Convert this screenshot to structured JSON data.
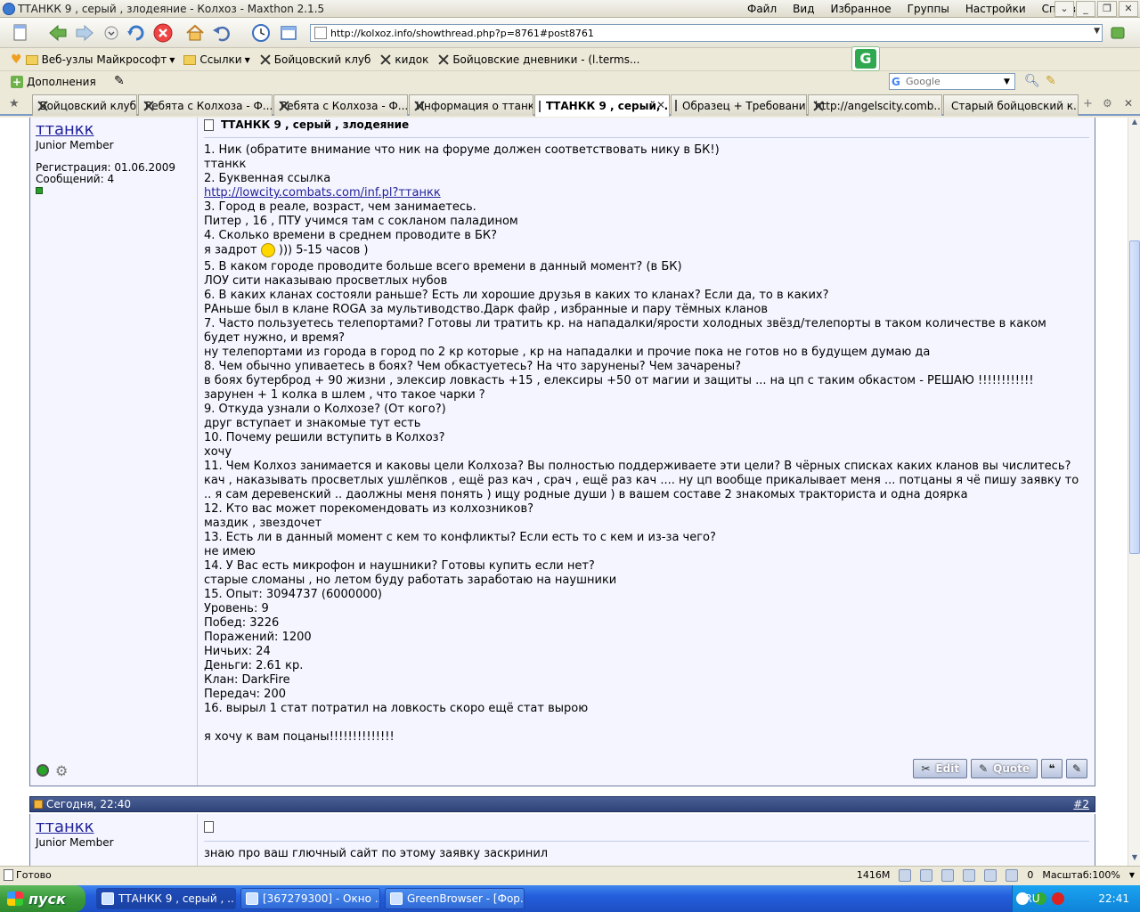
{
  "window": {
    "title": "ТТАНКК 9 , серый , злодеяние - Колхоз - Maxthon 2.1.5",
    "menu": [
      "Файл",
      "Вид",
      "Избранное",
      "Группы",
      "Настройки",
      "Справка"
    ]
  },
  "address": {
    "url": "http://kolxoz.info/showthread.php?p=8761#post8761"
  },
  "links": [
    "Веб-узлы Майкрософт",
    "Ссылки",
    "Бойцовский клуб",
    "кидок",
    "Бойцовские дневники - (l.terms..."
  ],
  "addons": {
    "label": "Дополнения"
  },
  "search": {
    "placeholder": "Google"
  },
  "tabs": [
    "Бойцовский клуб",
    "Ребята с Колхоза - Ф...",
    "Ребята с Колхоза - Ф...",
    "Информация о ттанкк",
    "ТТАНКК 9 , серый, ...",
    "Образец + Требовани...",
    "http://angelscity.comb...",
    "Старый бойцовский к..."
  ],
  "post1": {
    "username": "ттанкк",
    "usertitle": "Junior Member",
    "reg": "Регистрация: 01.06.2009",
    "posts": "Сообщений: 4",
    "title": "ТТАНКК 9 , серый , злодеяние",
    "lines": [
      "1. Ник (обратите внимание что ник на форуме должен соответствовать нику в БК!)",
      "ттанкк",
      "2. Буквенная ссылка",
      "http://lowcity.combats.com/inf.pl?ттанкк",
      "3. Город в реале, возраст, чем занимаетесь.",
      "Питер , 16 , ПТУ учимся там с сокланом паладином",
      "4. Сколько времени в среднем проводите в БК?",
      "я задрот  ))) 5-15 часов )",
      "5. В каком городе проводите больше всего времени в данный момент? (в БК)",
      "ЛОУ сити наказываю просветлых нубов",
      "6. В каких кланах состояли раньше? Есть ли хорошие друзья в каких то кланах? Если да, то в каких?",
      "РАньше был в клане ROGA за мультиводство.Дарк файр , избранные и пару тёмных кланов",
      "7. Часто пользуетесь телепортами? Готовы ли тратить кр. на нападалки/ярости холодных звёзд/телепорты в таком количестве в каком будет нужно, и время?",
      "ну телепортами из города в город по 2 кр которые , кр на нападалки и прочие пока не готов но в будущем думаю да",
      "8. Чем обычно упиваетесь в боях? Чем обкастуетесь? На что зарунены? Чем зачарены?",
      "в боях бутерброд + 90 жизни , элексир ловкасть +15 , елексиры +50 от магии и защиты ... на цп с таким обкастом - РЕШАЮ !!!!!!!!!!!!",
      "зарунен + 1 колка в шлем , что такое чарки ?",
      "9. Откуда узнали о Колхозе? (От кого?)",
      "друг вступает и знакомые тут есть",
      "10. Почему решили вступить в Колхоз?",
      "хочу",
      "11. Чем Колхоз занимается и каковы цели Колхоза? Вы полностью поддерживаете эти цели? В чёрных списках каких кланов вы числитесь?",
      "кач , наказывать просветлых ушлёпков , ещё раз кач , срач , ещё раз кач .... ну цп вообще прикалывает меня ... потцаны я чё пишу заявку то .. я сам деревенский .. даолжны меня понять ) ищу родные души ) в вашем составе 2 знакомых тракториста и одна доярка",
      "12. Кто вас может порекомендовать из колхозников?",
      "маздик , звездочет",
      "13. Есть ли в данный момент с кем то конфликты? Если есть то с кем и из-за чего?",
      "не имею",
      "14. У Вас есть микрофон и наушники? Готовы купить если нет?",
      "старые сломаны , но летом буду работать заработаю на наушники",
      "15. Опыт: 3094737 (6000000)",
      "Уровень: 9",
      "Побед: 3226",
      "Поражений: 1200",
      "Ничьих: 24",
      "Деньги: 2.61 кр.",
      "Клан: DarkFire",
      "Передач: 200",
      "16. вырыл 1 стат потратил на ловкость скоро ещё стат вырою",
      "",
      "я хочу к вам поцаны!!!!!!!!!!!!!!"
    ],
    "edit_label": "Edit",
    "quote_label": "Quote"
  },
  "post2": {
    "date": "Сегодня, 22:40",
    "number": "#2",
    "username": "ттанкк",
    "usertitle": "Junior Member",
    "text": "знаю про ваш глючный сайт по этому заявку заскринил"
  },
  "status": {
    "ready": "Готово",
    "memory": "1416M",
    "counter": "0",
    "zoom": "Масштаб:100%"
  },
  "taskbar": {
    "start": "пуск",
    "tasks": [
      "ТТАНКК 9 , серый , ...",
      "[367279300] - Окно ...",
      "GreenBrowser - [Фор..."
    ],
    "lang": "RU",
    "time": "22:41"
  }
}
